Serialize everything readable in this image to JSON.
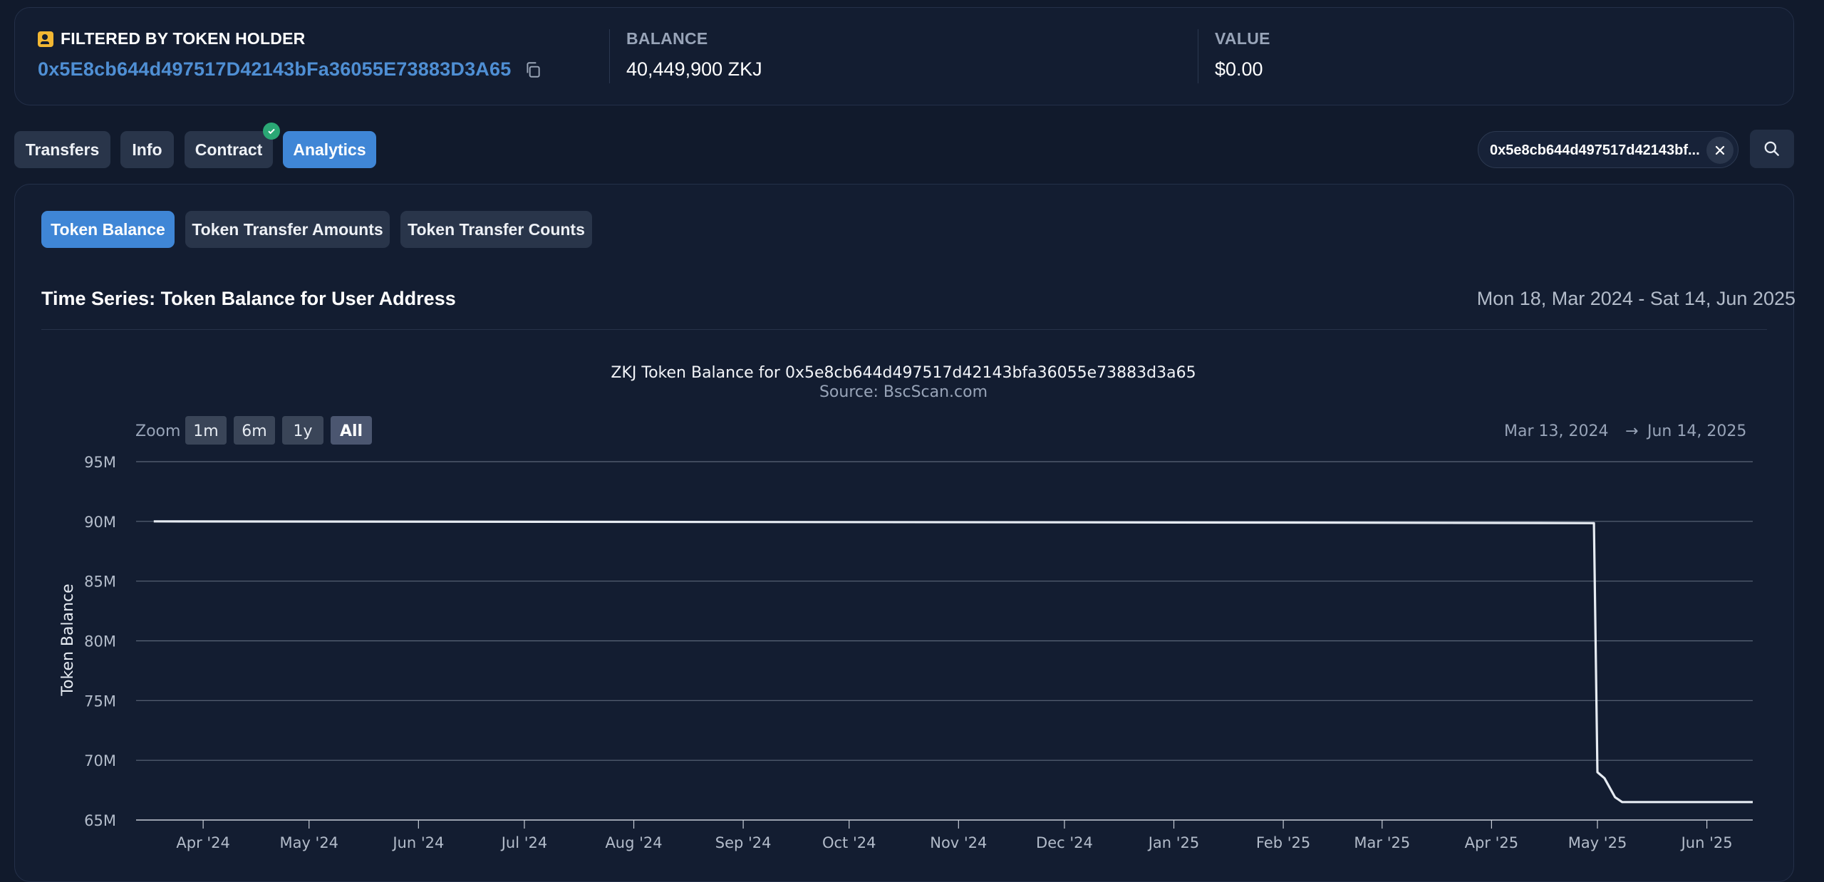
{
  "filter": {
    "label": "FILTERED BY TOKEN HOLDER",
    "address": "0x5E8cb644d497517D42143bFa36055E73883D3A65",
    "icon": "contact-card-icon",
    "balance_label": "BALANCE",
    "balance_value": "40,449,900 ZKJ",
    "value_label": "VALUE",
    "value_value": "$0.00"
  },
  "tabs": [
    {
      "label": "Transfers",
      "active": false
    },
    {
      "label": "Info",
      "active": false
    },
    {
      "label": "Contract",
      "active": false,
      "verified": true
    },
    {
      "label": "Analytics",
      "active": true
    }
  ],
  "search": {
    "value": "0x5e8cb644d497517d42143bf..."
  },
  "subtabs": [
    {
      "label": "Token Balance",
      "active": true
    },
    {
      "label": "Token Transfer Amounts",
      "active": false
    },
    {
      "label": "Token Transfer Counts",
      "active": false
    }
  ],
  "section": {
    "title": "Time Series: Token Balance for User Address",
    "date_range": "Mon 18, Mar 2024 - Sat 14, Jun 2025"
  },
  "zoom": {
    "label": "Zoom",
    "buttons": [
      "1m",
      "6m",
      "1y",
      "All"
    ],
    "selected": "All",
    "range_from": "Mar 13, 2024",
    "range_arrow": "→",
    "range_to": "Jun 14, 2025"
  },
  "colors": {
    "accent": "#3f86d6",
    "line": "#e6ebf2",
    "background": "#131d31"
  },
  "chart_data": {
    "type": "line",
    "title": "ZKJ Token Balance for 0x5e8cb644d497517d42143bfa36055e73883d3a65",
    "subtitle": "Source: BscScan.com",
    "ylabel": "Token Balance",
    "xlabel": "",
    "ylim": [
      65000000,
      95000000
    ],
    "yticks": [
      "65M",
      "70M",
      "75M",
      "80M",
      "85M",
      "90M",
      "95M"
    ],
    "xlim": [
      "2024-03-13",
      "2025-06-14"
    ],
    "xticks": [
      {
        "label": "Apr '24",
        "date": "2024-04-01"
      },
      {
        "label": "May '24",
        "date": "2024-05-01"
      },
      {
        "label": "Jun '24",
        "date": "2024-06-01"
      },
      {
        "label": "Jul '24",
        "date": "2024-07-01"
      },
      {
        "label": "Aug '24",
        "date": "2024-08-01"
      },
      {
        "label": "Sep '24",
        "date": "2024-09-01"
      },
      {
        "label": "Oct '24",
        "date": "2024-10-01"
      },
      {
        "label": "Nov '24",
        "date": "2024-11-01"
      },
      {
        "label": "Dec '24",
        "date": "2024-12-01"
      },
      {
        "label": "Jan '25",
        "date": "2025-01-01"
      },
      {
        "label": "Feb '25",
        "date": "2025-02-01"
      },
      {
        "label": "Mar '25",
        "date": "2025-03-01"
      },
      {
        "label": "Apr '25",
        "date": "2025-04-01"
      },
      {
        "label": "May '25",
        "date": "2025-05-01"
      },
      {
        "label": "Jun '25",
        "date": "2025-06-01"
      }
    ],
    "grid": true,
    "series": [
      {
        "points": [
          [
            "2024-03-18",
            90000000
          ],
          [
            "2024-09-01",
            89950000
          ],
          [
            "2025-02-01",
            89900000
          ],
          [
            "2025-04-30",
            89850000
          ],
          [
            "2025-05-01",
            69000000
          ],
          [
            "2025-05-03",
            68500000
          ],
          [
            "2025-05-06",
            66900000
          ],
          [
            "2025-05-08",
            66500000
          ],
          [
            "2025-06-14",
            66500000
          ]
        ]
      }
    ]
  }
}
